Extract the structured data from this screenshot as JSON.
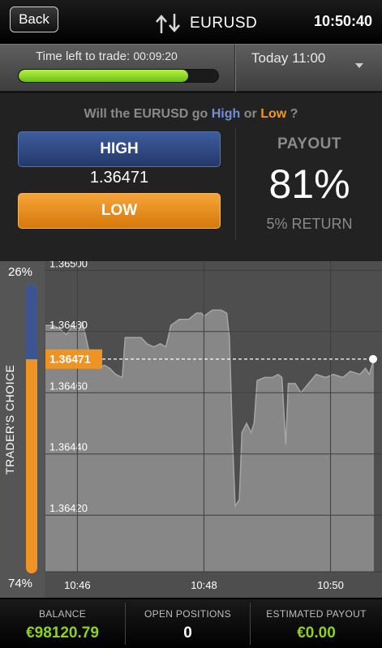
{
  "header": {
    "back_label": "Back",
    "asset": "EURUSD",
    "clock": "10:50:40"
  },
  "timer": {
    "label": "Time left to trade:",
    "value": "00:09:20",
    "progress_fraction": 0.85,
    "expiry": "Today 11:00"
  },
  "trade": {
    "question_prefix": "Will the EURUSD go",
    "high_word": "High",
    "or_word": "or",
    "low_word": "Low",
    "question_suffix": "?",
    "high_button": "HIGH",
    "low_button": "LOW",
    "strike": "1.36471",
    "payout_label": "PAYOUT",
    "payout_value": "81%",
    "return_label": "5% RETURN"
  },
  "sentiment": {
    "high_pct_label": "26%",
    "low_pct_label": "74%",
    "high_fraction": 0.26,
    "caption": "TRADER'S CHOICE"
  },
  "chart_data": {
    "type": "area",
    "y_ticks": [
      "1.36500",
      "1.36480",
      "1.36460",
      "1.36440",
      "1.36420"
    ],
    "x_ticks": [
      "10:46",
      "10:48",
      "10:50"
    ],
    "x_tick_values": [
      10.7667,
      10.8,
      10.8333
    ],
    "ylim": [
      1.364015,
      1.36503
    ],
    "xlim": [
      10.7583,
      10.8447
    ],
    "current_price_label": "1.36471",
    "current_price": 1.36471,
    "points": [
      [
        10.7583,
        1.36482
      ],
      [
        10.7602,
        1.36482
      ],
      [
        10.762,
        1.36481
      ],
      [
        10.7638,
        1.36479
      ],
      [
        10.7655,
        1.36482
      ],
      [
        10.767,
        1.3648
      ],
      [
        10.768,
        1.36483
      ],
      [
        10.7688,
        1.36479
      ],
      [
        10.7695,
        1.36475
      ],
      [
        10.7705,
        1.36469
      ],
      [
        10.772,
        1.36468
      ],
      [
        10.7738,
        1.36469
      ],
      [
        10.7752,
        1.36468
      ],
      [
        10.7768,
        1.36466
      ],
      [
        10.7785,
        1.36465
      ],
      [
        10.7793,
        1.36478
      ],
      [
        10.781,
        1.36478
      ],
      [
        10.7835,
        1.36478
      ],
      [
        10.785,
        1.36476
      ],
      [
        10.7868,
        1.36475
      ],
      [
        10.7885,
        1.36476
      ],
      [
        10.79,
        1.36475
      ],
      [
        10.7913,
        1.36482
      ],
      [
        10.7935,
        1.36484
      ],
      [
        10.796,
        1.36484
      ],
      [
        10.798,
        1.36486
      ],
      [
        10.7993,
        1.36486
      ],
      [
        10.8,
        1.36485
      ],
      [
        10.8022,
        1.36487
      ],
      [
        10.8045,
        1.36487
      ],
      [
        10.806,
        1.36486
      ],
      [
        10.8067,
        1.36478
      ],
      [
        10.8075,
        1.36445
      ],
      [
        10.8082,
        1.36423
      ],
      [
        10.8093,
        1.36425
      ],
      [
        10.81,
        1.36447
      ],
      [
        10.8112,
        1.3645
      ],
      [
        10.8124,
        1.36447
      ],
      [
        10.8132,
        1.3645
      ],
      [
        10.814,
        1.36464
      ],
      [
        10.816,
        1.36465
      ],
      [
        10.818,
        1.36465
      ],
      [
        10.8195,
        1.36466
      ],
      [
        10.8205,
        1.36465
      ],
      [
        10.8215,
        1.36443
      ],
      [
        10.8222,
        1.36463
      ],
      [
        10.824,
        1.36463
      ],
      [
        10.8255,
        1.3646
      ],
      [
        10.8275,
        1.36463
      ],
      [
        10.8295,
        1.36466
      ],
      [
        10.832,
        1.36465
      ],
      [
        10.834,
        1.36466
      ],
      [
        10.8365,
        1.36465
      ],
      [
        10.8385,
        1.36467
      ],
      [
        10.841,
        1.36466
      ],
      [
        10.8425,
        1.36468
      ],
      [
        10.8435,
        1.36466
      ],
      [
        10.8447,
        1.36471
      ]
    ]
  },
  "footer": {
    "balance_label": "BALANCE",
    "balance_value": "€98120.79",
    "positions_label": "OPEN POSITIONS",
    "positions_value": "0",
    "est_label": "ESTIMATED PAYOUT",
    "est_value": "€0.00"
  },
  "colors": {
    "high": "#3b5592",
    "low": "#ef9325",
    "green": "#8fd21d",
    "chart_bg": "#4e4e4e",
    "area_fill": "#8a8a8a"
  }
}
